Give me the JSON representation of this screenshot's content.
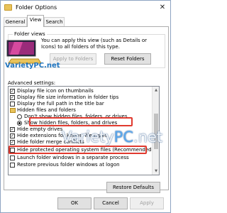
{
  "window": {
    "title": "Folder Options",
    "close_glyph": "✕"
  },
  "tabs": [
    {
      "label": "General"
    },
    {
      "label": "View"
    },
    {
      "label": "Search"
    }
  ],
  "folder_views": {
    "legend": "Folder views",
    "description": "You can apply this view (such as Details or Icons) to all folders of this type.",
    "apply_button": "Apply to Folders",
    "reset_button": "Reset Folders"
  },
  "advanced": {
    "label": "Advanced settings:",
    "items": [
      {
        "type": "checkbox",
        "checked": true,
        "label": "Display file icon on thumbnails"
      },
      {
        "type": "checkbox",
        "checked": true,
        "label": "Display file size information in folder tips"
      },
      {
        "type": "checkbox",
        "checked": false,
        "label": "Display the full path in the title bar"
      },
      {
        "type": "folder",
        "label": "Hidden files and folders"
      },
      {
        "type": "radio",
        "checked": false,
        "label": "Don't show hidden files, folders, or drives"
      },
      {
        "type": "radio",
        "checked": true,
        "label": "Show hidden files, folders, and drives"
      },
      {
        "type": "checkbox",
        "checked": true,
        "label": "Hide empty drives"
      },
      {
        "type": "checkbox",
        "checked": true,
        "label": "Hide extensions for known file types"
      },
      {
        "type": "checkbox",
        "checked": true,
        "label": "Hide folder merge conflicts"
      },
      {
        "type": "checkbox",
        "checked": false,
        "label": "Hide protected operating system files (Recommended)"
      },
      {
        "type": "checkbox",
        "checked": false,
        "label": "Launch folder windows in a separate process"
      },
      {
        "type": "checkbox",
        "checked": false,
        "label": "Restore previous folder windows at logon"
      }
    ],
    "restore_button": "Restore Defaults"
  },
  "footer": {
    "ok": "OK",
    "cancel": "Cancel",
    "apply": "Apply"
  },
  "watermark": {
    "logo_text": "VarietyPC.net",
    "overlay_main": "Variety",
    "overlay_accent": "PC",
    "overlay_suffix": ".net"
  },
  "colors": {
    "highlight": "#e03a2f",
    "accent": "#0078d7",
    "folder": "#e9c35a"
  }
}
